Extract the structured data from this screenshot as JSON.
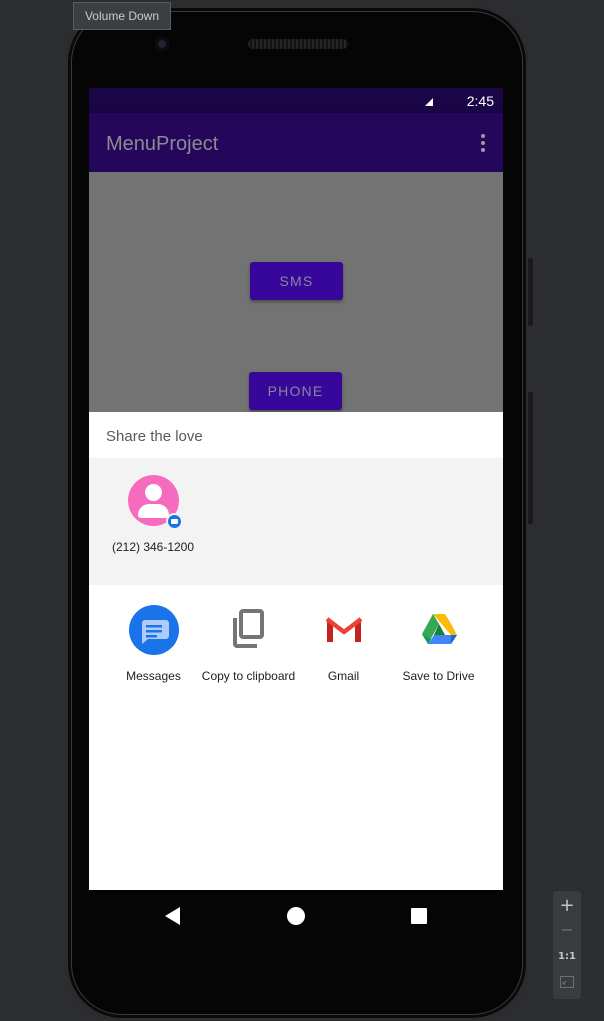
{
  "emulator": {
    "tooltip": "Volume Down",
    "zoom_in_label": "+",
    "zoom_out_label": "−",
    "zoom_actual_label": "1:1",
    "zoom_fit_icon": "fit-screen-icon"
  },
  "status_bar": {
    "time": "2:45",
    "signal_icon": "signal-icon"
  },
  "app_bar": {
    "title": "MenuProject",
    "overflow_icon": "more-vert-icon"
  },
  "main": {
    "sms_button": "SMS",
    "phone_button": "PHONE"
  },
  "share_sheet": {
    "title": "Share the love",
    "direct_share": [
      {
        "label": "(212) 346-1200",
        "icon": "contact-avatar-icon",
        "badge_icon": "messages-badge-icon"
      }
    ],
    "targets": [
      {
        "label": "Messages",
        "icon": "messages-icon"
      },
      {
        "label": "Copy to clipboard",
        "icon": "copy-icon"
      },
      {
        "label": "Gmail",
        "icon": "gmail-icon"
      },
      {
        "label": "Save to Drive",
        "icon": "drive-icon"
      }
    ]
  },
  "nav_bar": {
    "back_icon": "back-icon",
    "home_icon": "home-icon",
    "recents_icon": "recents-icon"
  },
  "colors": {
    "status_bar": "#1a0547",
    "app_bar": "#24075a",
    "button": "#37069a",
    "scrim": "#737373",
    "avatar": "#f76bbf",
    "messages_blue": "#1a73e8"
  }
}
